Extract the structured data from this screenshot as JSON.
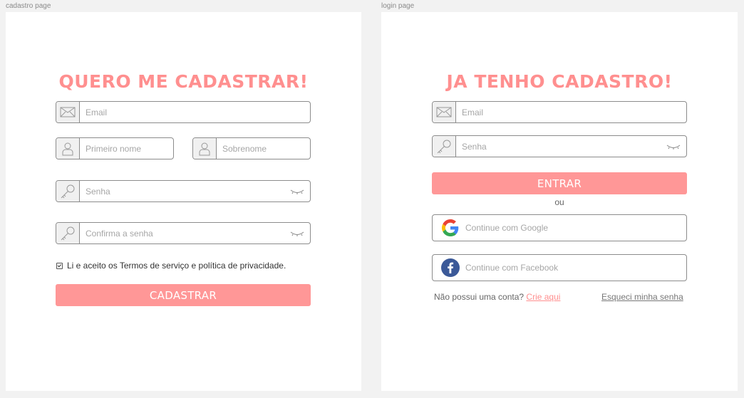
{
  "frames": {
    "cadastro": {
      "label": "cadastro page",
      "title": "QUERO ME CADASTRAR!",
      "email_placeholder": "Email",
      "first_name_placeholder": "Primeiro nome",
      "last_name_placeholder": "Sobrenome",
      "password_placeholder": "Senha",
      "confirm_password_placeholder": "Confirma a senha",
      "terms_text": "Li e aceito os Termos de serviço e política de privacidade.",
      "submit_label": "CADASTRAR"
    },
    "login": {
      "label": "login page",
      "title": "JA TENHO CADASTRO!",
      "email_placeholder": "Email",
      "password_placeholder": "Senha",
      "submit_label": "ENTRAR",
      "or_text": "ou",
      "google_label": "Continue com Google",
      "facebook_label": "Continue com Facebook",
      "no_account_text": "Não possui uma conta?",
      "create_link": "Crie aqui",
      "forgot_link": "Esqueci minha senha"
    }
  },
  "icons": {
    "email": "envelope-icon",
    "user": "user-icon",
    "key": "key-icon",
    "eye": "eye-closed-icon",
    "google": "google-icon",
    "facebook": "facebook-icon"
  },
  "colors": {
    "accent": "#ff8f8f",
    "button": "#ff9797",
    "facebook": "#3b5998"
  }
}
